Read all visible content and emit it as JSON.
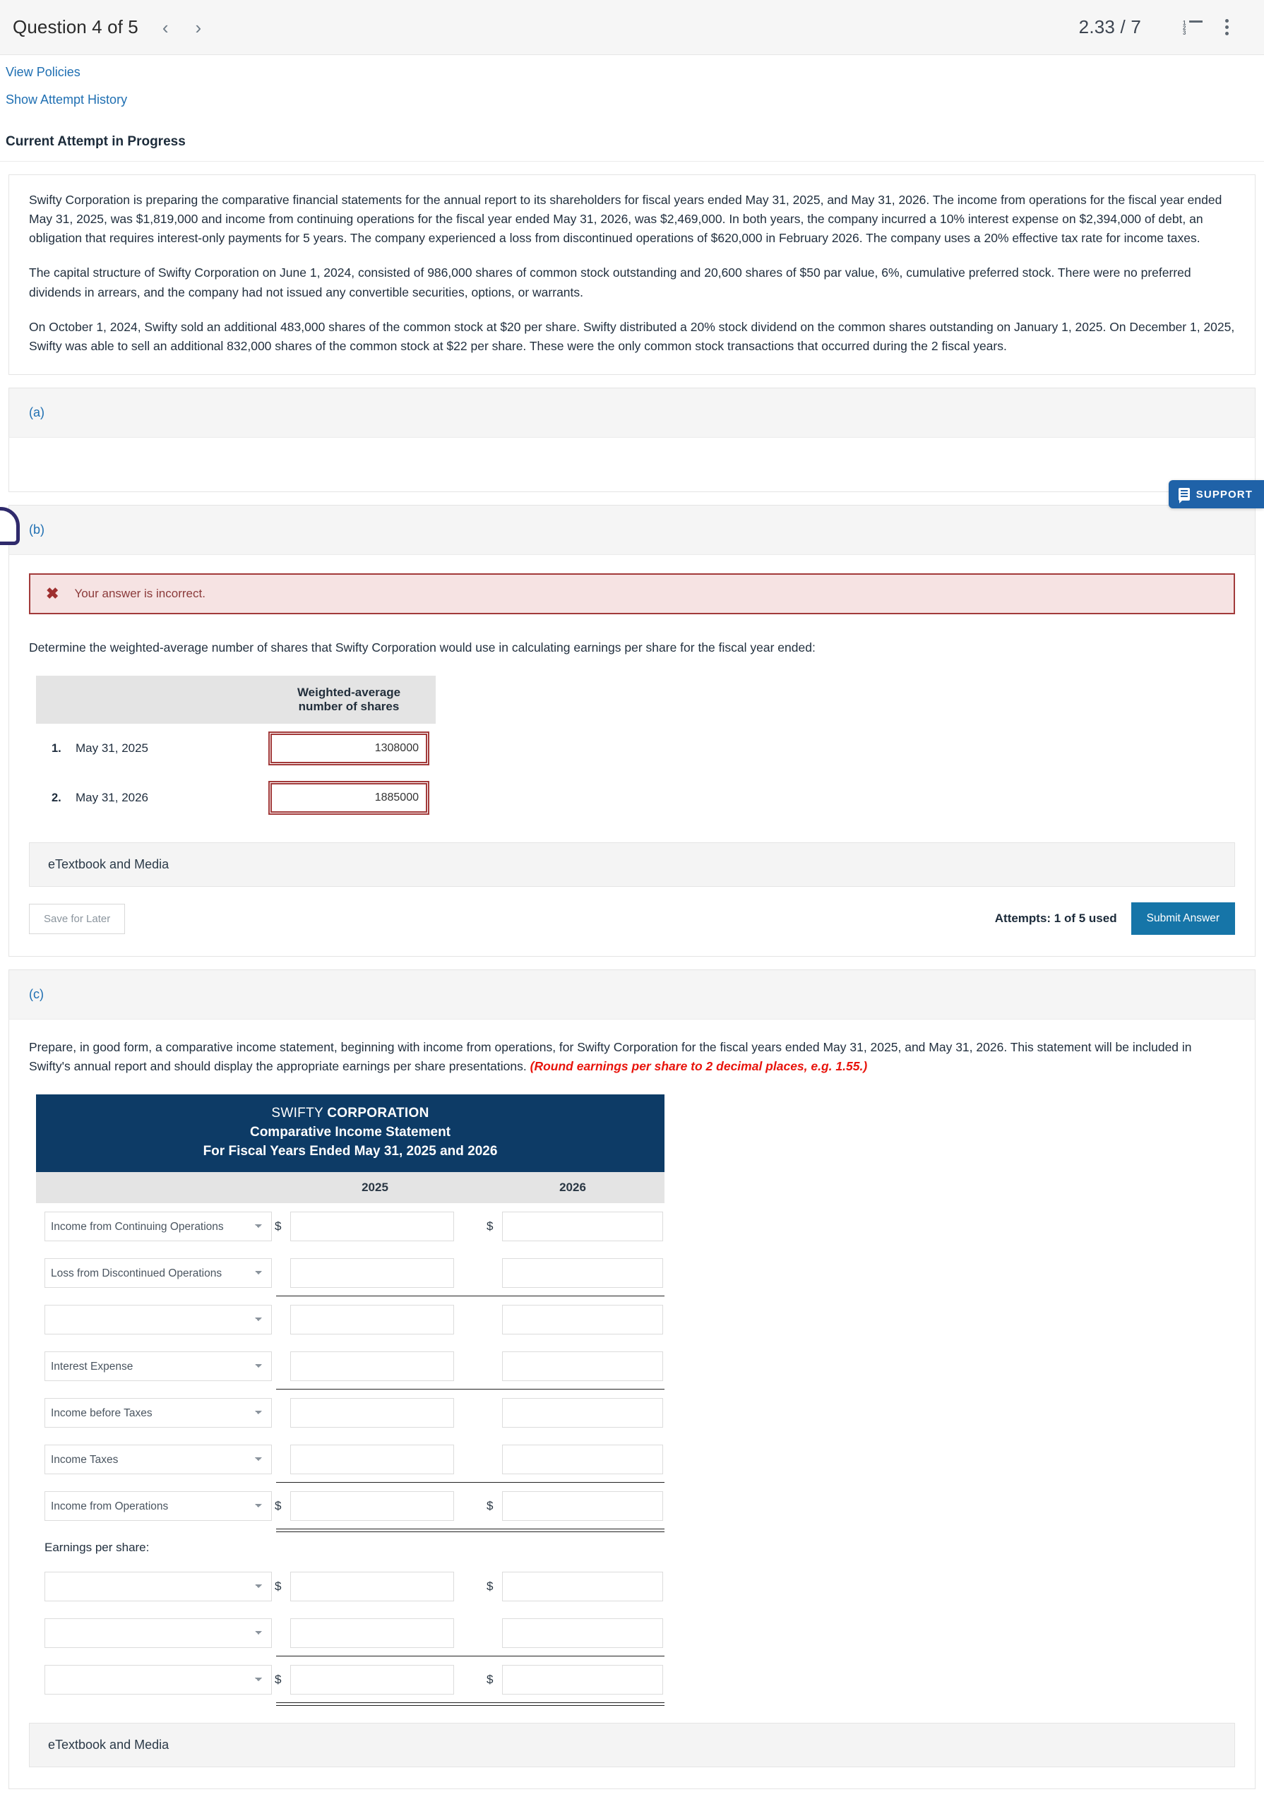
{
  "header": {
    "question_title": "Question 4 of 5",
    "prev_arrow": "‹",
    "next_arrow": "›",
    "score": "2.33 / 7",
    "list_icon": "numbered-list-icon",
    "menu_icon": "kebab-menu-icon"
  },
  "links": {
    "view_policies": "View Policies",
    "show_attempt_history": "Show Attempt History",
    "current_attempt": "Current Attempt in Progress"
  },
  "problem": {
    "p1": "Swifty Corporation is preparing the comparative financial statements for the annual report to its shareholders for fiscal years ended May 31, 2025, and May 31, 2026. The income from operations for the fiscal year ended May 31, 2025, was $1,819,000 and income from continuing operations for the fiscal year ended May 31, 2026, was $2,469,000. In both years, the company incurred a 10% interest expense on $2,394,000 of debt, an obligation that requires interest-only payments for 5 years. The company experienced a loss from discontinued operations of $620,000 in February 2026. The company uses a 20% effective tax rate for income taxes.",
    "p2": "The capital structure of Swifty Corporation on June 1, 2024, consisted of 986,000 shares of common stock outstanding and 20,600 shares of $50 par value, 6%, cumulative preferred stock. There were no preferred dividends in arrears, and the company had not issued any convertible securities, options, or warrants.",
    "p3": "On October 1, 2024, Swifty sold an additional 483,000 shares of the common stock at $20 per share. Swifty distributed a 20% stock dividend on the common shares outstanding on January 1, 2025. On December 1, 2025, Swifty was able to sell an additional 832,000 shares of the common stock at $22 per share. These were the only common stock transactions that occurred during the 2 fiscal years."
  },
  "part_a": {
    "label": "(a)"
  },
  "part_b": {
    "label": "(b)",
    "alert_icon": "x-mark-icon",
    "alert_text": "Your answer is incorrect.",
    "instruction": "Determine the weighted-average number of shares that Swifty Corporation would use in calculating earnings per share for the fiscal year ended:",
    "table": {
      "header_blank": "",
      "header_shares": "Weighted-average number of shares",
      "rows": [
        {
          "num": "1.",
          "date": "May 31, 2025",
          "value": "1308000"
        },
        {
          "num": "2.",
          "date": "May 31, 2026",
          "value": "1885000"
        }
      ]
    },
    "etextbook": "eTextbook and Media",
    "save_for_later": "Save for Later",
    "attempts": "Attempts: 1 of 5 used",
    "submit": "Submit Answer"
  },
  "part_c": {
    "label": "(c)",
    "instruction_plain": "Prepare, in good form, a comparative income statement, beginning with income from operations, for Swifty Corporation for the fiscal years ended May 31, 2025, and May 31, 2026. This statement will be included in Swifty's annual report and should display the appropriate earnings per share presentations.",
    "instruction_red": "(Round earnings per share to 2 decimal places, e.g. 1.55.)",
    "statement": {
      "company_light": "SWIFTY ",
      "company_bold": "CORPORATION",
      "title": "Comparative Income Statement",
      "period": "For Fiscal Years Ended May 31, 2025 and 2026",
      "col_2025": "2025",
      "col_2026": "2026",
      "rows": [
        {
          "account": "Income from Continuing Operations",
          "dollar2025": "$",
          "dollar2026": "$",
          "v2025": "",
          "v2026": "",
          "rule": "none"
        },
        {
          "account": "Loss from Discontinued Operations",
          "dollar2025": "",
          "dollar2026": "",
          "v2025": "",
          "v2026": "",
          "rule": "single"
        },
        {
          "account": "",
          "dollar2025": "",
          "dollar2026": "",
          "v2025": "",
          "v2026": "",
          "rule": "none"
        },
        {
          "account": "Interest Expense",
          "dollar2025": "",
          "dollar2026": "",
          "v2025": "",
          "v2026": "",
          "rule": "single"
        },
        {
          "account": "Income before Taxes",
          "dollar2025": "",
          "dollar2026": "",
          "v2025": "",
          "v2026": "",
          "rule": "none"
        },
        {
          "account": "Income Taxes",
          "dollar2025": "",
          "dollar2026": "",
          "v2025": "",
          "v2026": "",
          "rule": "single"
        },
        {
          "account": "Income from Operations",
          "dollar2025": "$",
          "dollar2026": "$",
          "v2025": "",
          "v2026": "",
          "rule": "double"
        }
      ],
      "eps_label": "Earnings per share:",
      "eps_rows": [
        {
          "account": "",
          "dollar2025": "$",
          "dollar2026": "$",
          "v2025": "",
          "v2026": "",
          "rule": "none"
        },
        {
          "account": "",
          "dollar2025": "",
          "dollar2026": "",
          "v2025": "",
          "v2026": "",
          "rule": "single"
        },
        {
          "account": "",
          "dollar2025": "$",
          "dollar2026": "$",
          "v2025": "",
          "v2026": "",
          "rule": "double"
        }
      ]
    },
    "etextbook": "eTextbook and Media"
  },
  "support": {
    "label": "SUPPORT",
    "icon": "support-chat-icon"
  },
  "colors": {
    "link_blue": "#1f6fb2",
    "statement_navy": "#0d3b66",
    "submit_blue": "#1675a8",
    "support_blue": "#1f62a8",
    "error_red": "#a23a3a",
    "red_note": "#e8140c"
  }
}
